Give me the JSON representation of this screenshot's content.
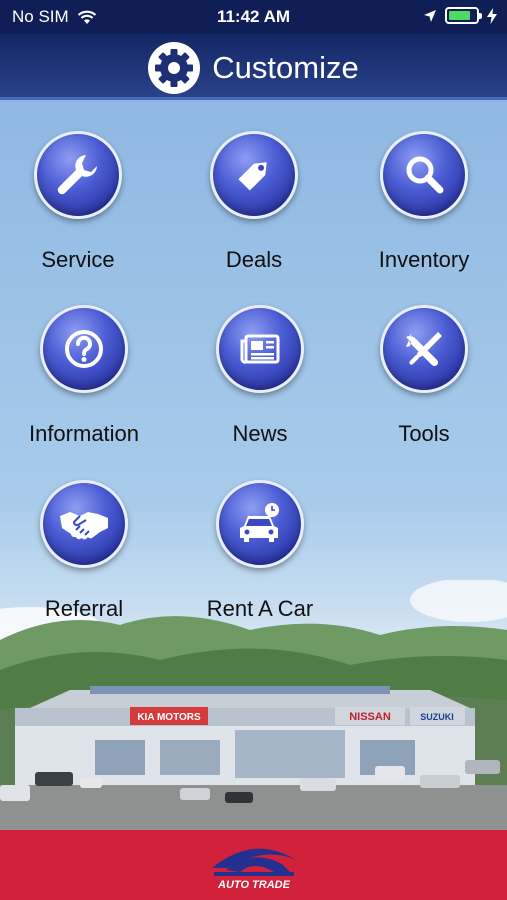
{
  "status_bar": {
    "carrier": "No SIM",
    "time": "11:42 AM",
    "battery_level": 0.8
  },
  "header": {
    "title": "Customize",
    "icon": "gear-icon"
  },
  "menu": [
    {
      "label": "Service",
      "icon": "wrench-icon"
    },
    {
      "label": "Deals",
      "icon": "price-tag-icon"
    },
    {
      "label": "Inventory",
      "icon": "magnifier-icon"
    },
    {
      "label": "Information",
      "icon": "question-icon"
    },
    {
      "label": "News",
      "icon": "newspaper-icon"
    },
    {
      "label": "Tools",
      "icon": "tools-icon"
    },
    {
      "label": "Referral",
      "icon": "handshake-icon"
    },
    {
      "label": "Rent A Car",
      "icon": "car-clock-icon"
    }
  ],
  "background": {
    "signs": [
      "KIA MOTORS",
      "NISSAN",
      "SUZUKI"
    ]
  },
  "footer": {
    "logo_text": "AUTO TRADE"
  },
  "colors": {
    "header": "#142766",
    "footer": "#d2213a",
    "icon": "#3f4fc8"
  }
}
